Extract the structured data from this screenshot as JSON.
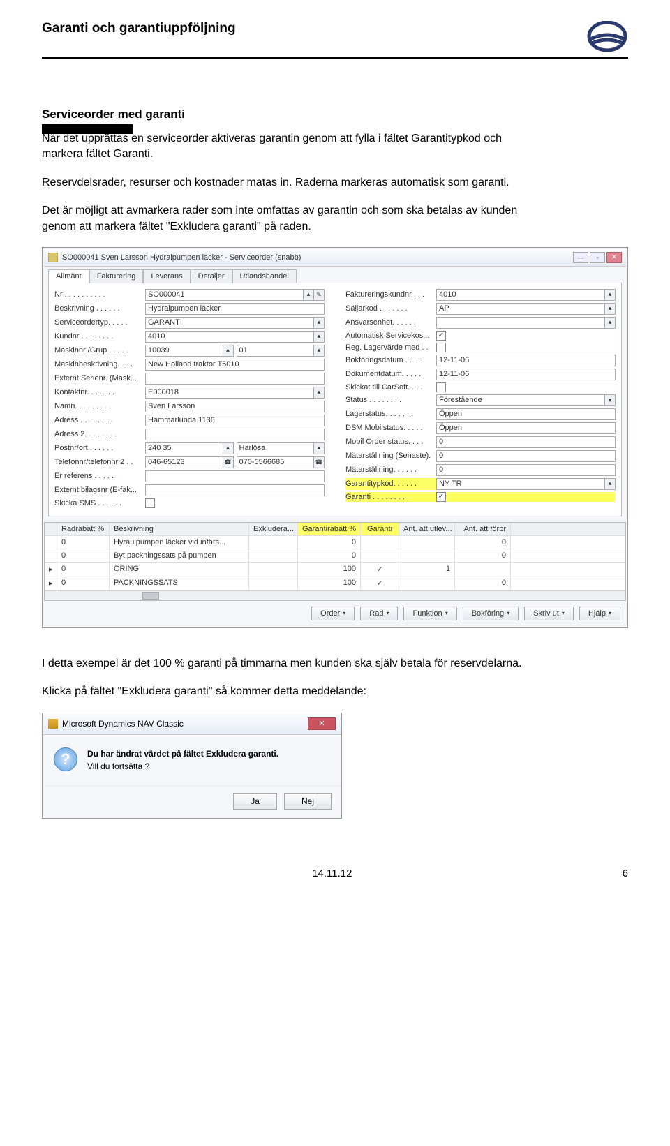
{
  "doc": {
    "title": "Garanti och garantiuppföljning",
    "section_title": "Serviceorder med garanti",
    "p1": "När det upprättas en serviceorder aktiveras garantin genom att fylla i fältet Garantitypkod och markera fältet Garanti.",
    "p2": "Reservdelsrader, resurser och kostnader matas in. Raderna markeras automatisk som garanti.",
    "p3": "Det är möjligt att avmarkera rader som inte omfattas av garantin och som ska betalas av kunden genom att markera fältet \"Exkludera garanti\" på raden.",
    "p4": "I detta exempel är det 100 % garanti på timmarna men kunden ska själv betala för reservdelarna.",
    "p5": "Klicka på fältet \"Exkludera garanti\" så kommer detta meddelande:",
    "footer_date": "14.11.12",
    "footer_page": "6"
  },
  "win": {
    "title": "SO000041 Sven Larsson Hydralpumpen läcker - Serviceorder (snabb)",
    "tabs": [
      "Allmänt",
      "Fakturering",
      "Leverans",
      "Detaljer",
      "Utlandshandel"
    ],
    "left_fields": [
      {
        "lbl": "Nr . . . . . . . . . .",
        "val": "SO000041",
        "lk": true,
        "pe": true
      },
      {
        "lbl": "Beskrivning . . . . . .",
        "val": "Hydralpumpen läcker"
      },
      {
        "lbl": "Serviceordertyp. . . . .",
        "val": "GARANTI",
        "lk": true
      },
      {
        "lbl": "Kundnr . . . . . . . .",
        "val": "4010",
        "lk": true
      },
      {
        "lbl": "Maskinnr /Grup . . . . .",
        "val": "10039",
        "lk": true,
        "extra": "01",
        "extralk": true
      },
      {
        "lbl": "Maskinbeskrivning. . . .",
        "val": "New Holland traktor T5010"
      },
      {
        "lbl": "Externt Serienr. (Mask...",
        "val": ""
      },
      {
        "lbl": "Kontaktnr. . . . . . .",
        "val": "E000018",
        "lk": true
      },
      {
        "lbl": "Namn. . . . . . . . .",
        "val": "Sven Larsson"
      },
      {
        "lbl": "Adress . . . . . . . .",
        "val": "Hammarlunda 1136"
      },
      {
        "lbl": "Adress 2. . . . . . . .",
        "val": ""
      },
      {
        "lbl": "Postnr/ort . . . . . .",
        "val": "240 35",
        "lk": true,
        "extra": "Harlösa",
        "extralk": true
      },
      {
        "lbl": "Telefonnr/telefonnr 2 . .",
        "val": "046-65123",
        "ph": true,
        "extra": "070-5566685",
        "ph2": true
      },
      {
        "lbl": "Er referens . . . . . .",
        "val": ""
      },
      {
        "lbl": "Externt bilagsnr (E-fak...",
        "val": ""
      },
      {
        "lbl": "Skicka SMS . . . . . .",
        "chk": ""
      }
    ],
    "right_fields": [
      {
        "lbl": "Faktureringskundnr . . .",
        "val": "4010",
        "lk": true
      },
      {
        "lbl": "Säljarkod . . . . . . .",
        "val": "AP",
        "lk": true
      },
      {
        "lbl": "Ansvarsenhet. . . . . .",
        "val": "",
        "lk": true
      },
      {
        "lbl": "Automatisk Servicekos...",
        "chk": "✓"
      },
      {
        "lbl": "Reg. Lagervärde med . .",
        "chk": ""
      },
      {
        "lbl": "Bokföringsdatum . . . .",
        "val": "12-11-06"
      },
      {
        "lbl": "Dokumentdatum. . . . .",
        "val": "12-11-06"
      },
      {
        "lbl": "Skickat till CarSoft. . . .",
        "chk": ""
      },
      {
        "lbl": "Status . . . . . . . .",
        "val": "Förestående",
        "dd": true
      },
      {
        "lbl": "Lagerstatus. . . . . . .",
        "val": "Öppen"
      },
      {
        "lbl": "DSM Mobilstatus. . . . .",
        "val": "Öppen"
      },
      {
        "lbl": "Mobil Order status. . . .",
        "val": "0"
      },
      {
        "lbl": "Mätarställning (Senaste).",
        "val": "0"
      },
      {
        "lbl": "Mätarställning. . . . . .",
        "val": "0"
      },
      {
        "lbl": "Garantitypkod. . . . . .",
        "val": "NY TR",
        "lk": true,
        "hl": true
      },
      {
        "lbl": "Garanti . . . . . . . .",
        "chk": "✓",
        "hl": true
      }
    ],
    "grid_headers": [
      "Radrabatt %",
      "Beskrivning",
      "Exkludera...",
      "Garantirabatt %",
      "Garanti",
      "Ant. att utlev...",
      "Ant. att förbr"
    ],
    "grid_header_hl": [
      false,
      false,
      false,
      true,
      true,
      false,
      false
    ],
    "grid_rows": [
      {
        "rd": "0",
        "b": "Hyraulpumpen läcker vid infärs...",
        "e": "",
        "gr": "0",
        "g": "",
        "au": "",
        "af": "0"
      },
      {
        "rd": "0",
        "b": "Byt packningssats på pumpen",
        "e": "",
        "gr": "0",
        "g": "",
        "au": "",
        "af": "0"
      },
      {
        "rd": "0",
        "b": "ORING",
        "e": "",
        "gr": "100",
        "g": "✓",
        "au": "1",
        "af": ""
      },
      {
        "rd": "0",
        "b": "PACKNINGSSATS",
        "e": "",
        "gr": "100",
        "g": "✓",
        "au": "",
        "af": "0"
      }
    ],
    "buttons": [
      "Order",
      "Rad",
      "Funktion",
      "Bokföring",
      "Skriv ut",
      "Hjälp"
    ]
  },
  "dialog": {
    "title": "Microsoft Dynamics NAV Classic",
    "line1": "Du har ändrat värdet på fältet Exkludera garanti.",
    "line2": "Vill du fortsätta ?",
    "yes": "Ja",
    "no": "Nej"
  }
}
